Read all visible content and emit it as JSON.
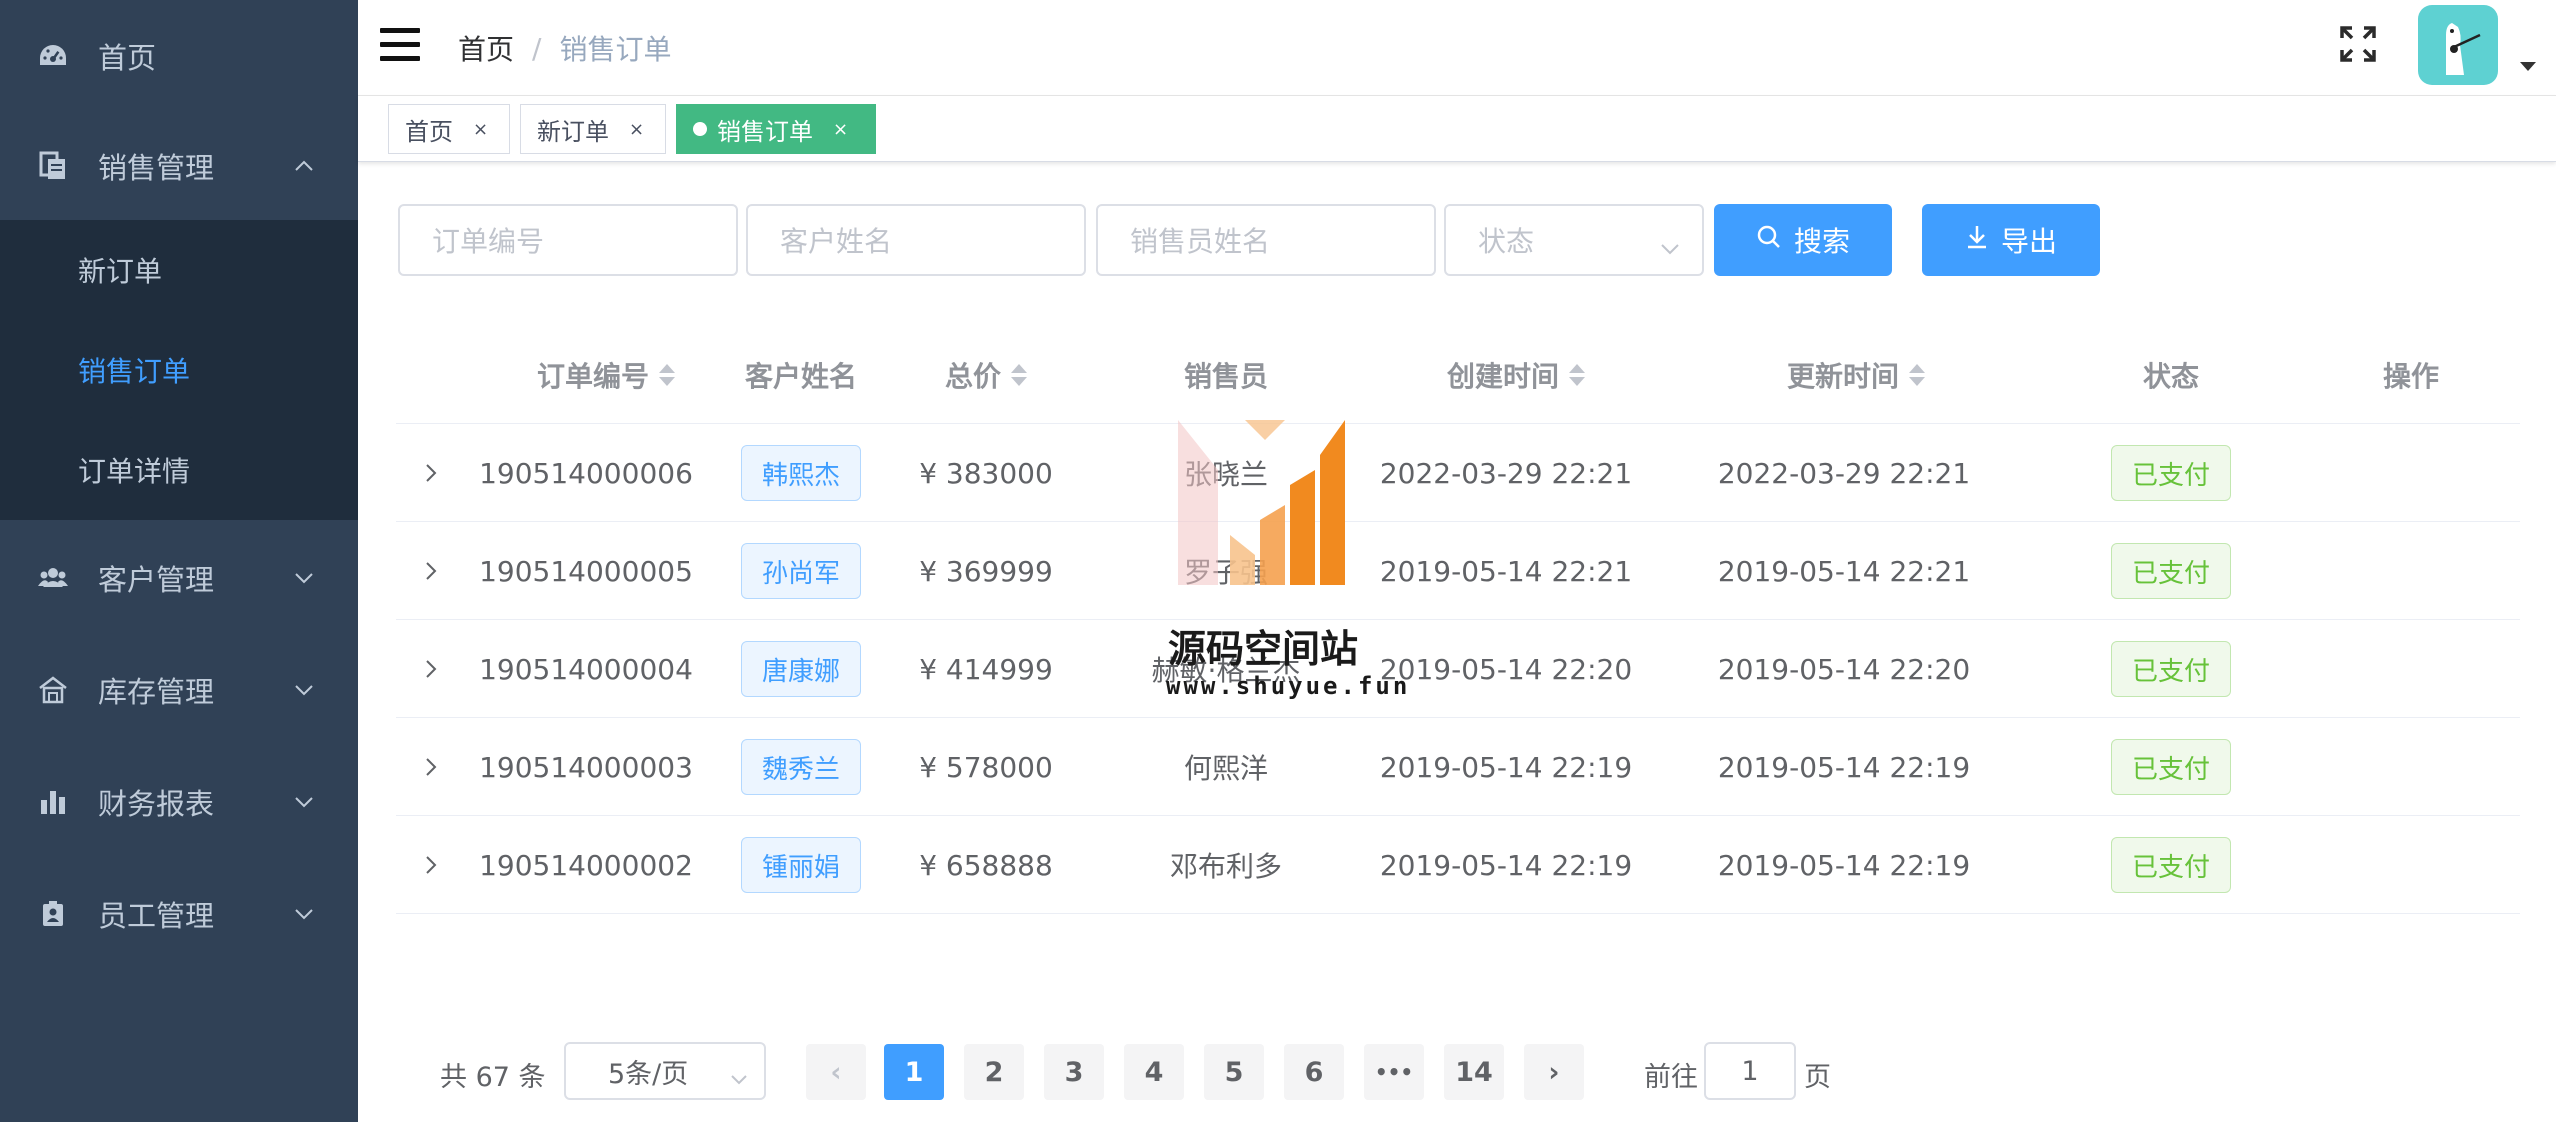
{
  "colors": {
    "sidebar_bg": "#304156",
    "submenu_bg": "#1f2d3d",
    "accent": "#409eff",
    "active_tag": "#42b983",
    "success": "#67c23a"
  },
  "sidebar": {
    "items": [
      {
        "label": "首页",
        "icon": "dashboard-icon"
      },
      {
        "label": "销售管理",
        "icon": "document-icon",
        "expanded": true
      },
      {
        "label": "客户管理",
        "icon": "people-icon"
      },
      {
        "label": "库存管理",
        "icon": "warehouse-icon"
      },
      {
        "label": "财务报表",
        "icon": "chart-icon"
      },
      {
        "label": "员工管理",
        "icon": "badge-icon"
      }
    ],
    "submenu": [
      "新订单",
      "销售订单",
      "订单详情"
    ],
    "active_sub": "销售订单"
  },
  "header": {
    "breadcrumb_home": "首页",
    "breadcrumb_sep": "/",
    "breadcrumb_current": "销售订单"
  },
  "tags": [
    {
      "label": "首页",
      "close": "×"
    },
    {
      "label": "新订单",
      "close": "×"
    },
    {
      "label": "销售订单",
      "close": "×",
      "active": true
    }
  ],
  "filters": {
    "order_no_placeholder": "订单编号",
    "customer_placeholder": "客户姓名",
    "seller_placeholder": "销售员姓名",
    "status_placeholder": "状态",
    "search_label": "搜索",
    "export_label": "导出"
  },
  "table": {
    "columns": [
      "订单编号",
      "客户姓名",
      "总价",
      "销售员",
      "创建时间",
      "更新时间",
      "状态",
      "操作"
    ],
    "rows": [
      {
        "order_no": "190514000006",
        "customer": "韩熙杰",
        "total": "¥ 383000",
        "seller": "张晓兰",
        "created": "2022-03-29 22:21",
        "updated": "2022-03-29 22:21",
        "status": "已支付"
      },
      {
        "order_no": "190514000005",
        "customer": "孙尚军",
        "total": "¥ 369999",
        "seller": "罗子强",
        "created": "2019-05-14 22:21",
        "updated": "2019-05-14 22:21",
        "status": "已支付"
      },
      {
        "order_no": "190514000004",
        "customer": "唐康娜",
        "total": "¥ 414999",
        "seller": "赫敏·格兰杰",
        "created": "2019-05-14 22:20",
        "updated": "2019-05-14 22:20",
        "status": "已支付"
      },
      {
        "order_no": "190514000003",
        "customer": "魏秀兰",
        "total": "¥ 578000",
        "seller": "何熙洋",
        "created": "2019-05-14 22:19",
        "updated": "2019-05-14 22:19",
        "status": "已支付"
      },
      {
        "order_no": "190514000002",
        "customer": "锺丽娟",
        "total": "¥ 658888",
        "seller": "邓布利多",
        "created": "2019-05-14 22:19",
        "updated": "2019-05-14 22:19",
        "status": "已支付"
      }
    ]
  },
  "pagination": {
    "total": "共 67 条",
    "page_size": "5条/页",
    "pages": [
      "1",
      "2",
      "3",
      "4",
      "5",
      "6",
      "•••",
      "14"
    ],
    "current": "1",
    "prev": "‹",
    "next": "›",
    "goto_prefix": "前往",
    "goto_value": "1",
    "goto_suffix": "页"
  },
  "watermark": {
    "title": "源码空间站",
    "url": "www.shuyue.fun"
  }
}
